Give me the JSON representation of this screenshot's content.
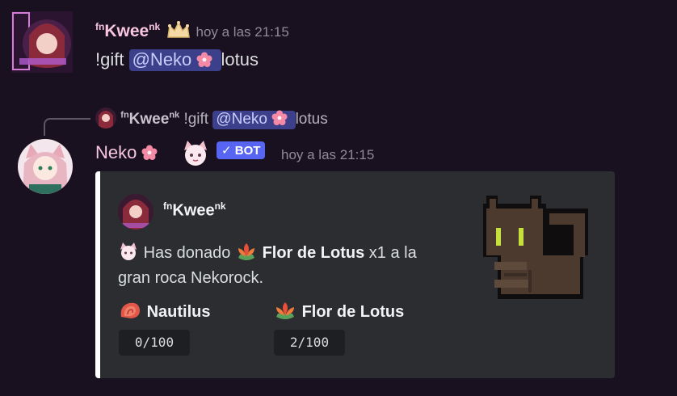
{
  "msg1": {
    "author_prefix": "fn",
    "author": "Kwee",
    "author_suffix": "nk",
    "timestamp": "hoy a las 21:15",
    "command": "!gift",
    "mention": "@Neko",
    "rest": "lotus"
  },
  "reply": {
    "author_prefix": "fn",
    "author": "Kwee",
    "author_suffix": "nk",
    "command": "!gift",
    "mention": "@Neko",
    "rest": "lotus"
  },
  "msg2": {
    "author": "Neko",
    "bot_badge": "BOT",
    "timestamp": "hoy a las 21:15",
    "embed": {
      "author_prefix": "fn",
      "author": "Kwee",
      "author_suffix": "nk",
      "desc_pre": "Has donado",
      "desc_item": "Flor de Lotus",
      "desc_post1": "x1 a la",
      "desc_post2": "gran roca Nekorock.",
      "fields": [
        {
          "name": "Nautilus",
          "value": "0/100"
        },
        {
          "name": "Flor de Lotus",
          "value": "2/100"
        }
      ]
    }
  },
  "colors": {
    "background": "#1a1120",
    "author_color": "#f7c6e0",
    "mention_bg": "#3c3f8a",
    "bot_badge": "#5865f2",
    "embed_bg": "#2b2d31"
  }
}
